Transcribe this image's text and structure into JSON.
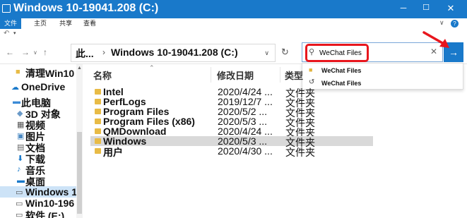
{
  "window": {
    "title": "Windows 10-19041.208 (C:)",
    "minimize": "─",
    "maximize": "☐",
    "close": "✕"
  },
  "ribbon": {
    "tabs": [
      "文件",
      "主页",
      "共享",
      "查看"
    ],
    "help": "?",
    "expand": "∨"
  },
  "qat": {
    "undo": "↶",
    "dropdown": "▾"
  },
  "nav": {
    "back": "←",
    "forward": "→",
    "recent": "∨",
    "up": "↑",
    "refresh": "↻"
  },
  "address": {
    "root": "此...",
    "separator": "›",
    "path": "Windows 10-19041.208 (C:)",
    "dropdown": "∨"
  },
  "search": {
    "value": "WeChat Files",
    "placeholder": "",
    "clear": "✕",
    "go": "→"
  },
  "suggestions": [
    {
      "icon": "folder-icon",
      "text": "WeChat Files"
    },
    {
      "icon": "history-icon",
      "text": "WeChat Files"
    }
  ],
  "sidebar": {
    "items": [
      {
        "icon": "folder-icon",
        "label": "清理Win10"
      },
      {
        "icon": "cloud-icon",
        "label": "OneDrive"
      },
      {
        "icon": "computer-icon",
        "label": "此电脑"
      },
      {
        "icon": "cube-icon",
        "label": "3D 对象"
      },
      {
        "icon": "video-icon",
        "label": "视频"
      },
      {
        "icon": "pictures-icon",
        "label": "图片"
      },
      {
        "icon": "documents-icon",
        "label": "文档"
      },
      {
        "icon": "download-icon",
        "label": "下载"
      },
      {
        "icon": "music-icon",
        "label": "音乐"
      },
      {
        "icon": "desktop-icon",
        "label": "桌面"
      },
      {
        "icon": "drive-icon",
        "label": "Windows 1"
      },
      {
        "icon": "drive-icon",
        "label": "Win10-196"
      },
      {
        "icon": "drive-icon",
        "label": "软件 (E:)"
      }
    ]
  },
  "columns": {
    "name": "名称",
    "date": "修改日期",
    "type": "类型"
  },
  "files": [
    {
      "name": "Intel",
      "date": "2020/4/24 ...",
      "type": "文件夹"
    },
    {
      "name": "PerfLogs",
      "date": "2019/12/7 ...",
      "type": "文件夹"
    },
    {
      "name": "Program Files",
      "date": "2020/5/2 ...",
      "type": "文件夹"
    },
    {
      "name": "Program Files (x86)",
      "date": "2020/5/3 ...",
      "type": "文件夹"
    },
    {
      "name": "QMDownload",
      "date": "2020/4/24 ...",
      "type": "文件夹"
    },
    {
      "name": "Windows",
      "date": "2020/5/3 ...",
      "type": "文件夹"
    },
    {
      "name": "用户",
      "date": "2020/4/30 ...",
      "type": "文件夹"
    }
  ],
  "colors": {
    "accent": "#1979ca",
    "highlight": "#e8161d",
    "folder": "#e8bb46",
    "selected_row": "#d9d9d9"
  }
}
